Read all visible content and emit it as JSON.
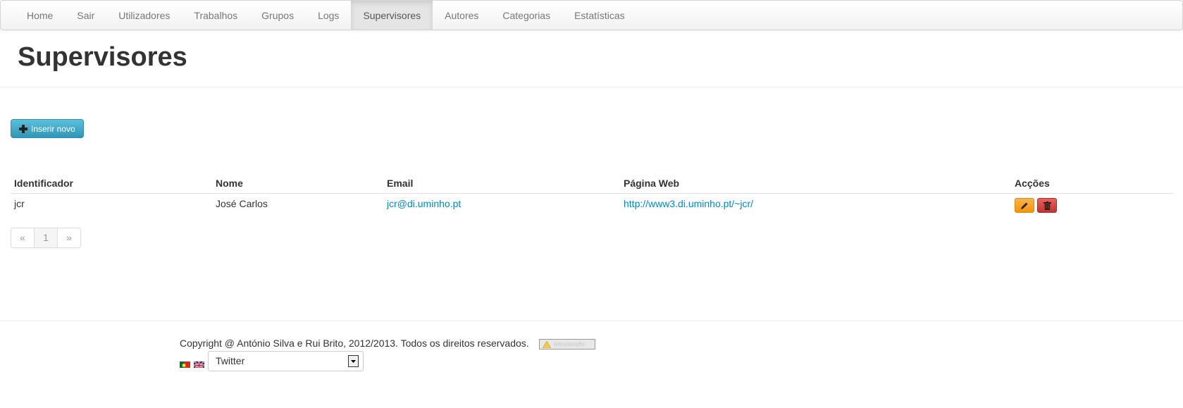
{
  "nav": {
    "items": [
      {
        "label": "Home"
      },
      {
        "label": "Sair"
      },
      {
        "label": "Utilizadores"
      },
      {
        "label": "Trabalhos"
      },
      {
        "label": "Grupos"
      },
      {
        "label": "Logs"
      },
      {
        "label": "Supervisores",
        "active": true
      },
      {
        "label": "Autores"
      },
      {
        "label": "Categorias"
      },
      {
        "label": "Estatísticas"
      }
    ]
  },
  "header": {
    "title": "Supervisores"
  },
  "insert_button": {
    "label": "Inserir novo",
    "icon": "plus-icon"
  },
  "table": {
    "columns": [
      "Identificador",
      "Nome",
      "Email",
      "Página Web",
      "Acções"
    ],
    "rows": [
      {
        "identificador": "jcr",
        "nome": "José Carlos",
        "email": "jcr@di.uminho.pt",
        "pagina_web": "http://www3.di.uminho.pt/~jcr/",
        "actions": [
          "pencil-icon",
          "trash-icon"
        ]
      }
    ]
  },
  "pagination": {
    "prev": "«",
    "current": "1",
    "next": "»"
  },
  "footer": {
    "copyright": "Copyright @ António Silva e Rui Brito, 2012/2013. Todos os direitos reservados.",
    "maintenance_badge": "Manutenção",
    "select_value": "Twitter"
  },
  "colors": {
    "info_button": "#49afcd",
    "warning_button": "#f89406",
    "danger_button": "#bd362f",
    "link": "#0088cc"
  }
}
